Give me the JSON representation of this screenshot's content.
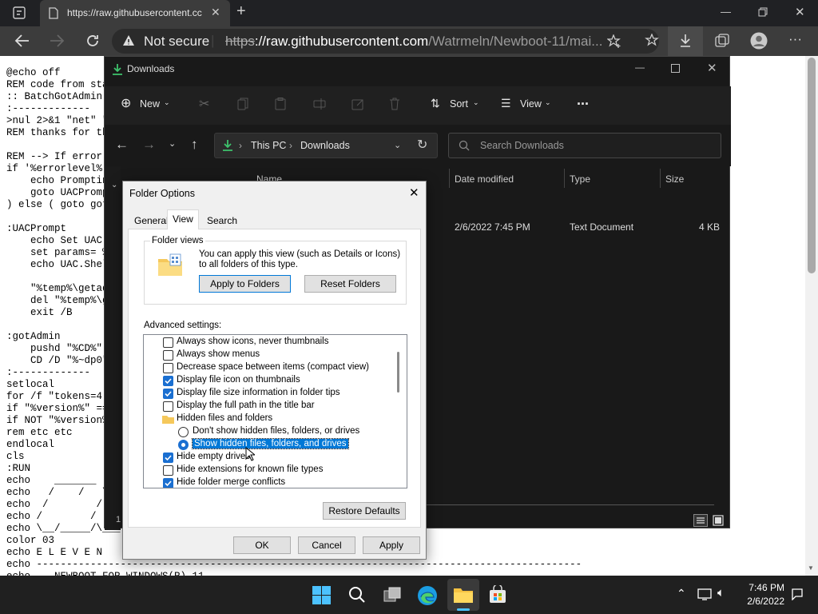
{
  "browser": {
    "tab_title": "https://raw.githubusercontent.cc",
    "security_label": "Not secure",
    "url_scheme": "https",
    "url_host": "://raw.githubusercontent.com",
    "url_path": "/Watrmeln/Newboot-11/mai..."
  },
  "page_lines": [
    "@echo off",
    "REM code from sta",
    ":: BatchGotAdmin",
    ":-------------",
    ">nul 2>&1 \"net\" \"",
    "REM thanks for th",
    "",
    "REM --> If error",
    "if '%errorlevel%'",
    "    echo Promptin",
    "    goto UACPromp",
    ") else ( goto got",
    "",
    ":UACPrompt",
    "    echo Set UAC",
    "    set params= %",
    "    echo UAC.Shel",
    "",
    "    \"%temp%\\getad",
    "    del \"%temp%\\g",
    "    exit /B",
    "",
    ":gotAdmin",
    "    pushd \"%CD%\"",
    "    CD /D \"%~dp0\"",
    ":-------------",
    "setlocal",
    "for /f \"tokens=4-",
    "if \"%version%\" ==",
    "if NOT \"%version%",
    "rem etc etc",
    "endlocal",
    "cls",
    ":RUN",
    "echo    _______",
    "echo   /    /   \\",
    "echo  /        /",
    "echo /        /",
    "echo \\__/_____/\\___",
    "color 03",
    "echo E L E V E N",
    "echo -------------------------------------------------------------------------------------------",
    "echo    NEWBOOT FOR WINDOWS(R) 11"
  ],
  "explorer": {
    "title": "Downloads",
    "toolbar": {
      "new": "New",
      "sort": "Sort",
      "view": "View",
      "more": "..."
    },
    "path": {
      "root": "This PC",
      "current": "Downloads"
    },
    "search_placeholder": "Search Downloads",
    "columns": {
      "name": "Name",
      "date": "Date modified",
      "type": "Type",
      "size": "Size"
    },
    "file": {
      "date": "2/6/2022 7:45 PM",
      "type": "Text Document",
      "size": "4 KB"
    },
    "status_count": "1"
  },
  "folder_options": {
    "title": "Folder Options",
    "tabs": {
      "general": "General",
      "view": "View",
      "search": "Search"
    },
    "folder_views_label": "Folder views",
    "folder_views_desc": "You can apply this view (such as Details or Icons) to all folders of this type.",
    "apply_to_folders": "Apply to Folders",
    "reset_folders": "Reset Folders",
    "advanced_label": "Advanced settings:",
    "items": [
      {
        "type": "checkbox",
        "checked": false,
        "label": "Always show icons, never thumbnails"
      },
      {
        "type": "checkbox",
        "checked": false,
        "label": "Always show menus"
      },
      {
        "type": "checkbox",
        "checked": false,
        "label": "Decrease space between items (compact view)"
      },
      {
        "type": "checkbox",
        "checked": true,
        "label": "Display file icon on thumbnails"
      },
      {
        "type": "checkbox",
        "checked": true,
        "label": "Display file size information in folder tips"
      },
      {
        "type": "checkbox",
        "checked": false,
        "label": "Display the full path in the title bar"
      },
      {
        "type": "folder",
        "label": "Hidden files and folders"
      },
      {
        "type": "radio",
        "checked": false,
        "label": "Don't show hidden files, folders, or drives"
      },
      {
        "type": "radio",
        "checked": true,
        "selected": true,
        "label": "Show hidden files, folders, and drives"
      },
      {
        "type": "checkbox",
        "checked": true,
        "label": "Hide empty drives"
      },
      {
        "type": "checkbox",
        "checked": false,
        "label": "Hide extensions for known file types"
      },
      {
        "type": "checkbox",
        "checked": true,
        "label": "Hide folder merge conflicts"
      }
    ],
    "restore_defaults": "Restore Defaults",
    "ok": "OK",
    "cancel": "Cancel",
    "apply": "Apply"
  },
  "taskbar": {
    "time": "7:46 PM",
    "date": "2/6/2022"
  },
  "colors": {
    "accent": "#1a6fd1",
    "selection": "#0078d7",
    "download_icon": "#3ec46d"
  }
}
